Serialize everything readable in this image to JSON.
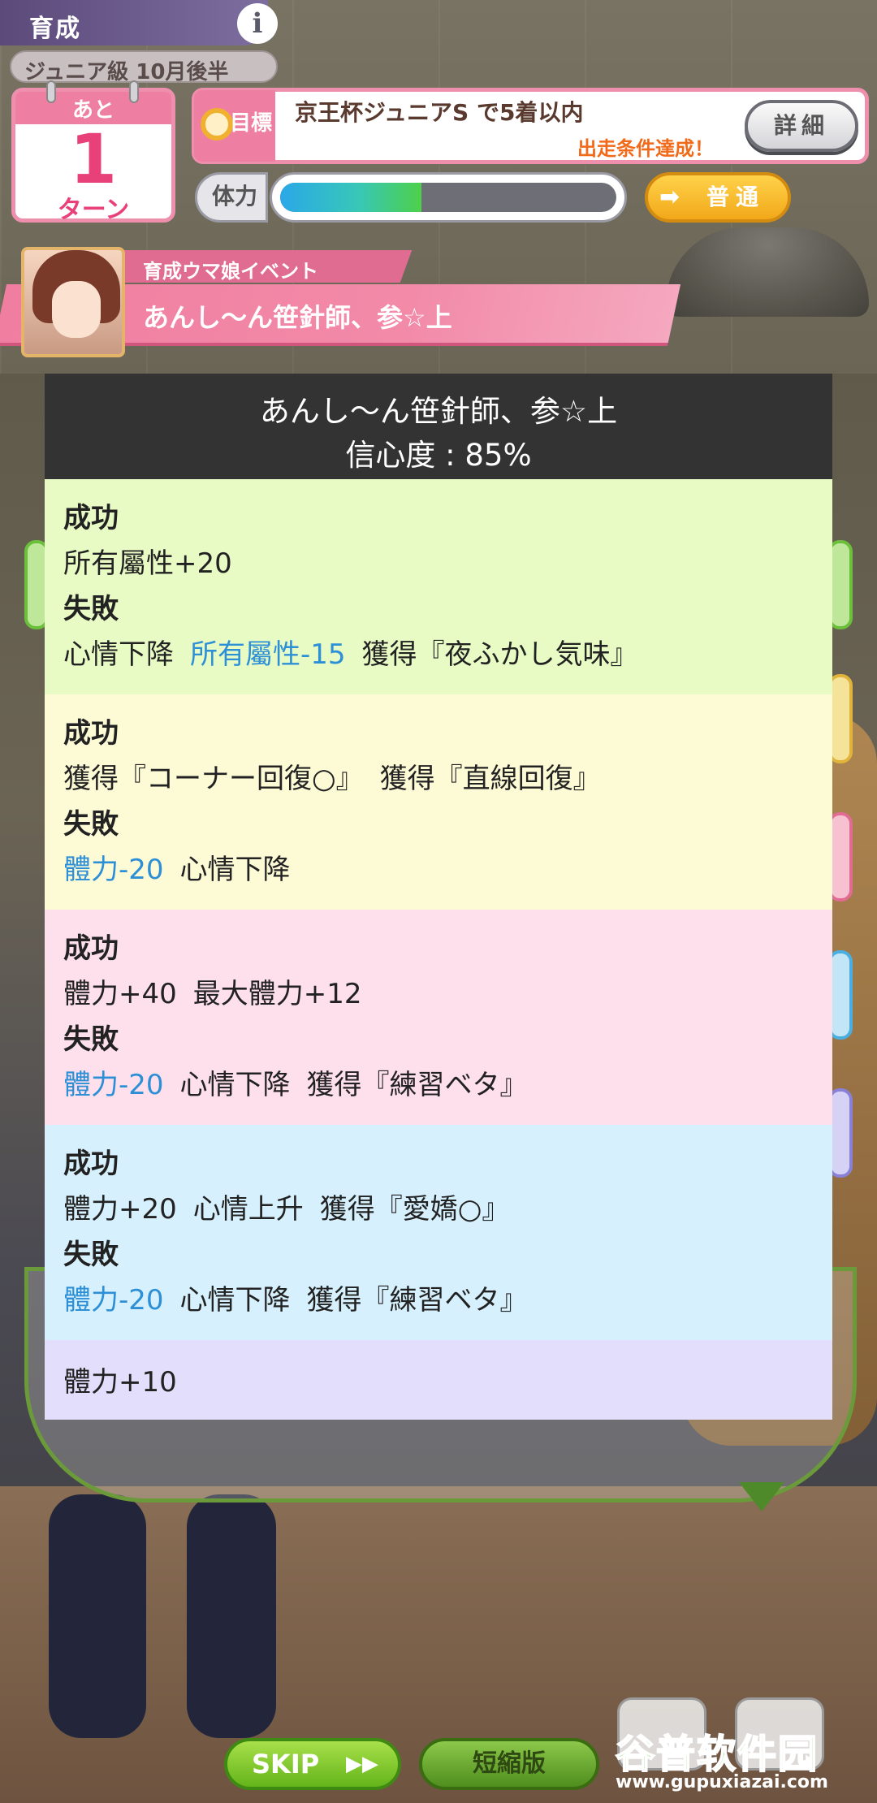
{
  "hud": {
    "header_title": "育成",
    "info_icon": "i",
    "date": "ジュニア級 10月後半"
  },
  "calendar": {
    "label": "あと",
    "number": "1",
    "unit": "ターン"
  },
  "goal": {
    "tag": "目標",
    "title": "京王杯ジュニアS で5着以内",
    "status": "出走条件達成！",
    "detail_button": "詳細"
  },
  "stamina": {
    "label": "体力",
    "fill_fraction": 0.42
  },
  "mood": {
    "label": "普通",
    "arrow_icon": "➡"
  },
  "event": {
    "subtitle": "育成ウマ娘イベント",
    "title": "あんし～ん笹針師、参☆上"
  },
  "panel": {
    "title": "あんし～ん笹針師、参☆上",
    "confidence": "信心度 : 85%",
    "options": [
      {
        "bg": "#e8fbc5",
        "success_label": "成功",
        "success": [
          "所有屬性+20"
        ],
        "failure_label": "失敗",
        "failure_parts": [
          {
            "text": "心情下降",
            "blue": false
          },
          {
            "text": "所有屬性-15",
            "blue": true
          },
          {
            "text": "獲得『夜ふかし気味』",
            "blue": false
          }
        ]
      },
      {
        "bg": "#fdfad6",
        "success_label": "成功",
        "success": [
          "獲得『コーナー回復○』",
          "獲得『直線回復』"
        ],
        "failure_label": "失敗",
        "failure_parts": [
          {
            "text": "體力-20",
            "blue": true
          },
          {
            "text": "心情下降",
            "blue": false
          }
        ]
      },
      {
        "bg": "#fee0ec",
        "success_label": "成功",
        "success": [
          "體力+40",
          "最大體力+12"
        ],
        "failure_label": "失敗",
        "failure_parts": [
          {
            "text": "體力-20",
            "blue": true
          },
          {
            "text": "心情下降",
            "blue": false
          },
          {
            "text": "獲得『練習ベタ』",
            "blue": false
          }
        ]
      },
      {
        "bg": "#d6f1fd",
        "success_label": "成功",
        "success": [
          "體力+20",
          "心情上升",
          "獲得『愛嬌○』"
        ],
        "failure_label": "失敗",
        "failure_parts": [
          {
            "text": "體力-20",
            "blue": true
          },
          {
            "text": "心情下降",
            "blue": false
          },
          {
            "text": "獲得『練習ベタ』",
            "blue": false
          }
        ]
      },
      {
        "bg": "#e2defb",
        "plain": "體力+10"
      }
    ]
  },
  "bottom": {
    "skip_label": "SKIP",
    "skip_arrows": "▶▶",
    "short_label": "短縮版"
  },
  "watermark": {
    "main": "谷普软件园",
    "url": "www.gupuxiazai.com"
  }
}
